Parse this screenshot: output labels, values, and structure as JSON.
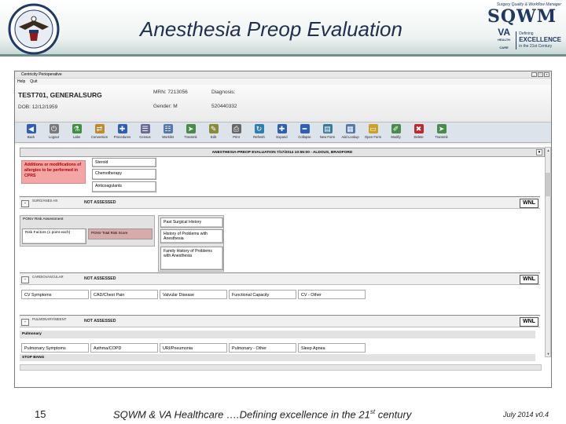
{
  "slide": {
    "title": "Anesthesia Preop Evaluation",
    "footer_number": "15",
    "footer_text_main": "SQWM & VA Healthcare ….Defining excellence in the 21",
    "footer_text_sup": "st",
    "footer_text_end": " century",
    "footer_date": "July 2014 v0.4"
  },
  "logo": {
    "top_text": "Surgery Quality & Workflow Manager",
    "name": "SQWM",
    "va": "VA",
    "va_sub": "HEALTH CARE",
    "defining": "Defining",
    "excellence": "EXCELLENCE",
    "century": "in the 21st Century"
  },
  "app": {
    "window_title": "Centricity Perioperative",
    "menu": [
      "Help",
      "Quit"
    ],
    "patient": {
      "name": "TEST701, GENERALSURG",
      "dob": "DOB:  12/12/1959",
      "mrn": "MRN:  7213056",
      "gender": "Gender:  M",
      "ssn": "520440332",
      "diagnosis": "Diagnosis:"
    },
    "toolbar": [
      {
        "label": "Back",
        "icon": "back-arrow-icon",
        "color": "#2e5fb0",
        "glyph": "◀"
      },
      {
        "label": "Logout",
        "icon": "logout-icon",
        "color": "#7a7a7a",
        "glyph": "⏻"
      },
      {
        "label": "Labs",
        "icon": "labs-icon",
        "color": "#3f8f3f",
        "glyph": "⚗"
      },
      {
        "label": "Conversion",
        "icon": "conversion-icon",
        "color": "#c0892b",
        "glyph": "⇄"
      },
      {
        "label": "Procedures",
        "icon": "procedures-icon",
        "color": "#2e5fb0",
        "glyph": "✚"
      },
      {
        "label": "Census",
        "icon": "census-icon",
        "color": "#6a6a9a",
        "glyph": "☰"
      },
      {
        "label": "Worklist",
        "icon": "worklist-icon",
        "color": "#5577aa",
        "glyph": "☷"
      },
      {
        "label": "Transmit",
        "icon": "transmit-icon",
        "color": "#4a8a4a",
        "glyph": "➤"
      },
      {
        "label": "Edit",
        "icon": "edit-icon",
        "color": "#8a8a3a",
        "glyph": "✎"
      },
      {
        "label": "Print",
        "icon": "print-icon",
        "color": "#666666",
        "glyph": "⎙"
      },
      {
        "label": "Refresh",
        "icon": "refresh-icon",
        "color": "#2e7fb0",
        "glyph": "↻"
      },
      {
        "label": "Expand",
        "icon": "expand-icon",
        "color": "#2e5fb0",
        "glyph": "✚"
      },
      {
        "label": "Collapse",
        "icon": "collapse-icon",
        "color": "#2e5fb0",
        "glyph": "━"
      },
      {
        "label": "New Form",
        "icon": "new-form-icon",
        "color": "#3a7a9a",
        "glyph": "▤"
      },
      {
        "label": "Add Lookup",
        "icon": "add-lookup-icon",
        "color": "#5577aa",
        "glyph": "▦"
      },
      {
        "label": "Open Form",
        "icon": "open-form-icon",
        "color": "#c9a227",
        "glyph": "▭"
      },
      {
        "label": "Modify",
        "icon": "modify-icon",
        "color": "#4a8a4a",
        "glyph": "✐"
      },
      {
        "label": "Delete",
        "icon": "delete-icon",
        "color": "#c0282b",
        "glyph": "✖"
      },
      {
        "label": "Transmit",
        "icon": "transmit-icon",
        "color": "#4a8a4a",
        "glyph": "➤"
      }
    ],
    "eval_header": "ANESTHESIA-PREOP EVALUATION 7/17/2014 10:55:00  -  ALDOUS, BRADFORD",
    "allergy_note": "Additions or modifications of allergies to be performed in CPRS",
    "meds": [
      "Steroid",
      "Chemotherapy",
      "Anticoagulants"
    ],
    "sections": {
      "surg": {
        "label": "SURG/ANES HX",
        "status": "NOT ASSESSED",
        "wnl": "WNL"
      },
      "cardio": {
        "label": "CARDIOVASCULAR",
        "status": "NOT ASSESSED",
        "wnl": "WNL"
      },
      "pulm": {
        "label": "PULMONARY/MEENT",
        "status": "NOT ASSESSED",
        "wnl": "WNL"
      }
    },
    "ponv": {
      "title": "PONV Risk Assessment",
      "risk_factors": "Risk Factors (1 point each)",
      "total": "PONV Total Risk Score"
    },
    "history": [
      "Past Surgical History",
      "History of Problems with Anesthesia",
      "Family History of Problems with Anesthesia"
    ],
    "cv_fields": [
      "CV Symptoms",
      "CAD/Chest Pain",
      "Valvular Disease",
      "Functional Capacity",
      "CV - Other"
    ],
    "pulmonary_band": "Pulmonary",
    "pulm_fields": [
      "Pulmonary Symptoms",
      "Asthma/COPD",
      "URI/Pneumonia",
      "Pulmonary - Other",
      "Sleep Apnea"
    ],
    "stop_bang": "STOP BANG"
  }
}
